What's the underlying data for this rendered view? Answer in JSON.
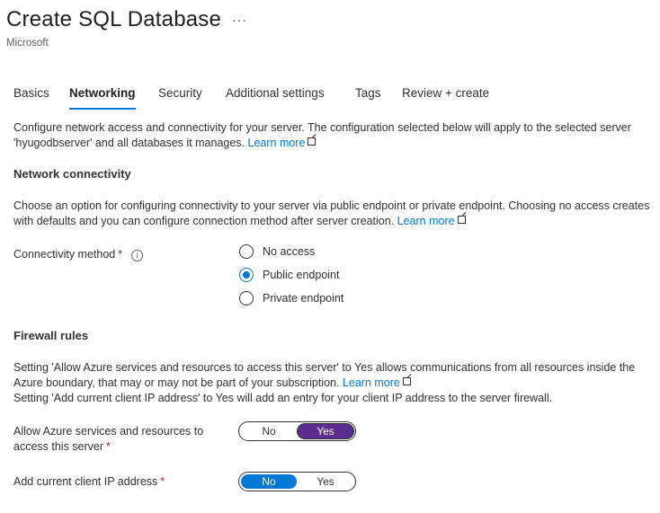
{
  "header": {
    "title": "Create SQL Database",
    "more": "···",
    "publisher": "Microsoft"
  },
  "tabs": [
    {
      "label": "Basics"
    },
    {
      "label": "Networking",
      "active": true
    },
    {
      "label": "Security"
    },
    {
      "label": "Additional settings"
    },
    {
      "label": "Tags"
    },
    {
      "label": "Review + create"
    }
  ],
  "intro": {
    "text": "Configure network access and connectivity for your server. The configuration selected below will apply to the selected server 'hyugodbserver' and all databases it manages. ",
    "link": "Learn more"
  },
  "network_connectivity": {
    "heading": "Network connectivity",
    "text": "Choose an option for configuring connectivity to your server via public endpoint or private endpoint. Choosing no access creates with defaults and you can configure connection method after server creation. ",
    "link": "Learn more",
    "method_label": "Connectivity method",
    "required": "*",
    "info": "i",
    "options": [
      {
        "label": "No access",
        "checked": false
      },
      {
        "label": "Public endpoint",
        "checked": true
      },
      {
        "label": "Private endpoint",
        "checked": false
      }
    ]
  },
  "firewall": {
    "heading": "Firewall rules",
    "text1": "Setting 'Allow Azure services and resources to access this server' to Yes allows communications from all resources inside the Azure boundary, that may or may not be part of your subscription. ",
    "link": "Learn more",
    "text2": "Setting 'Add current client IP address' to Yes will add an entry for your client IP address to the server firewall.",
    "allow_azure": {
      "label": "Allow Azure services and resources to access this server",
      "required": "*",
      "no": "No",
      "yes": "Yes",
      "value": "Yes"
    },
    "client_ip": {
      "label": "Add current client IP address",
      "required": "*",
      "no": "No",
      "yes": "Yes",
      "value": "No"
    }
  },
  "colors": {
    "accent": "#0078d4",
    "toggle_yes_selected": "#5c2d91",
    "required": "#a4262c"
  }
}
